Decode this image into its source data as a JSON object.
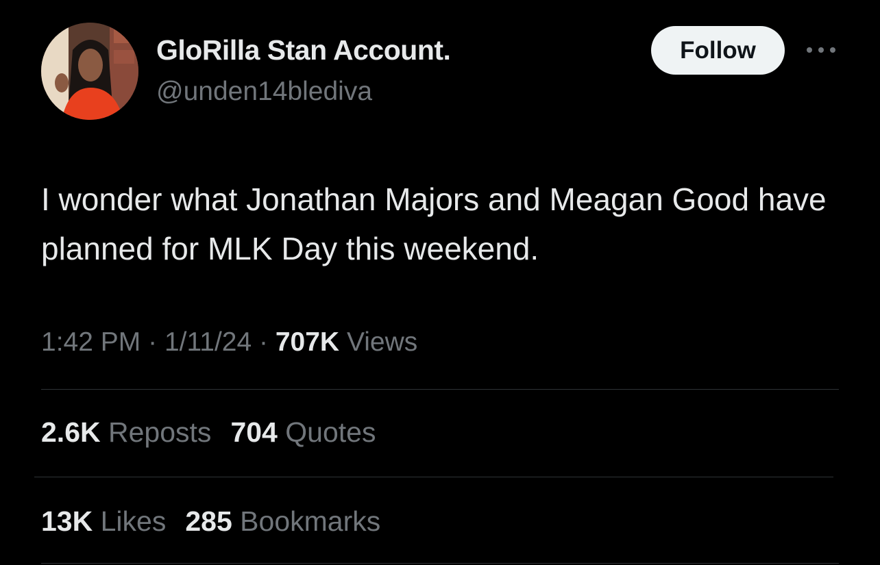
{
  "author": {
    "display_name": "GloRilla Stan Account.",
    "handle": "@unden14blediva"
  },
  "actions": {
    "follow_label": "Follow",
    "more_icon": "more-horizontal-icon"
  },
  "tweet": {
    "text": "I wonder what Jonathan Majors and Meagan Good have planned for MLK Day this weekend.",
    "time": "1:42 PM",
    "date": "1/11/24",
    "separator": "·",
    "views_count": "707K",
    "views_label": "Views"
  },
  "stats_row1": [
    {
      "count": "2.6K",
      "label": "Reposts"
    },
    {
      "count": "704",
      "label": "Quotes"
    }
  ],
  "stats_row2": [
    {
      "count": "13K",
      "label": "Likes"
    },
    {
      "count": "285",
      "label": "Bookmarks"
    }
  ],
  "colors": {
    "background": "#000000",
    "primary_text": "#e7e9ea",
    "secondary_text": "#71767b",
    "follow_button_bg": "#eff3f4",
    "divider": "#2f3336"
  }
}
